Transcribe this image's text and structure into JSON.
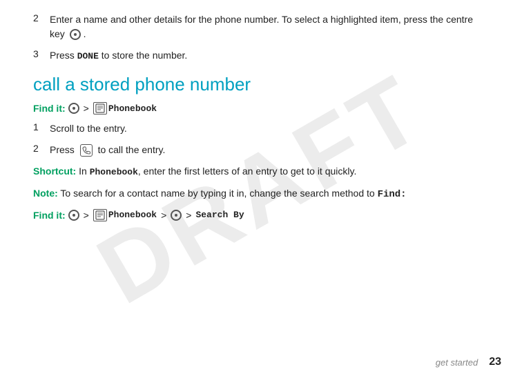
{
  "watermark": "DRAFT",
  "steps": [
    {
      "number": "2",
      "text": "Enter a name and other details for the phone number. To select a highlighted item, press the centre key"
    },
    {
      "number": "3",
      "text_before": "Press ",
      "done_label": "DONE",
      "text_after": " to store the number."
    }
  ],
  "section": {
    "heading": "call a stored phone number",
    "find_it_label": "Find it:",
    "find_it_arrow": ">",
    "find_it_phonebook": "Phonebook"
  },
  "numbered_steps": [
    {
      "number": "1",
      "text": "Scroll to the entry."
    },
    {
      "number": "2",
      "text": "Press",
      "icon": "call",
      "text_after": "to call the entry."
    }
  ],
  "shortcut": {
    "label": "Shortcut:",
    "text_before": "In ",
    "phonebook": "Phonebook",
    "text_after": ", enter the first letters of an entry to get to it quickly."
  },
  "note": {
    "label": "Note:",
    "text": "To search for a contact name by typing it in, change the search method to",
    "find_label": "Find:"
  },
  "find_it2": {
    "label": "Find it:",
    "arrow1": ">",
    "phonebook": "Phonebook",
    "arrow2": ">",
    "arrow3": ">",
    "search_by": "Search By"
  },
  "footer": {
    "get_started": "get started",
    "page_number": "23"
  }
}
